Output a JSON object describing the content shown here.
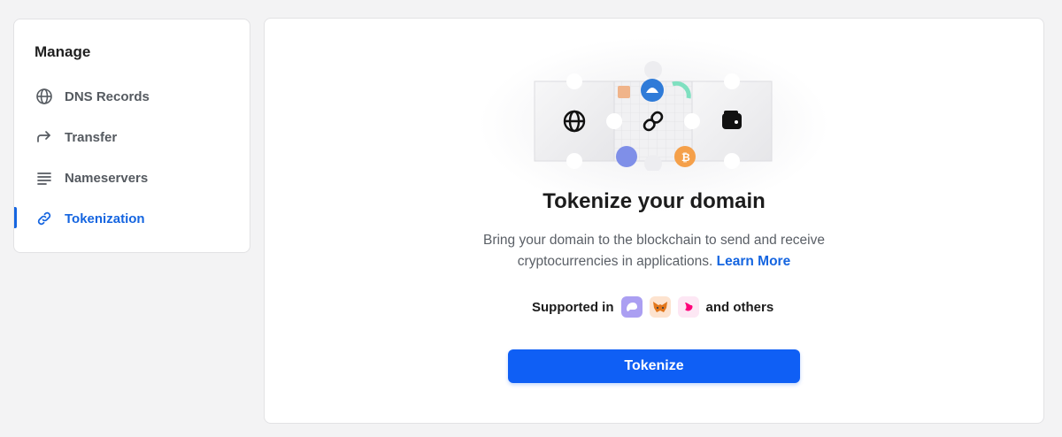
{
  "sidebar": {
    "title": "Manage",
    "items": [
      {
        "label": "DNS Records",
        "icon": "globe-icon",
        "active": false
      },
      {
        "label": "Transfer",
        "icon": "forward-arrow-icon",
        "active": false
      },
      {
        "label": "Nameservers",
        "icon": "lines-icon",
        "active": false
      },
      {
        "label": "Tokenization",
        "icon": "link-icon",
        "active": true
      }
    ]
  },
  "main": {
    "heading": "Tokenize your domain",
    "description_line1": "Bring your domain to the blockchain to send and receive",
    "description_line2": "cryptocurrencies in applications.",
    "learn_more": "Learn More",
    "supported_label": "Supported in",
    "supported_suffix": "and others",
    "wallets": [
      "phantom-icon",
      "metamask-icon",
      "uniswap-icon"
    ],
    "button_label": "Tokenize"
  },
  "colors": {
    "accent": "#1565e0",
    "button": "#0f5ff5",
    "background": "#f3f3f4"
  }
}
